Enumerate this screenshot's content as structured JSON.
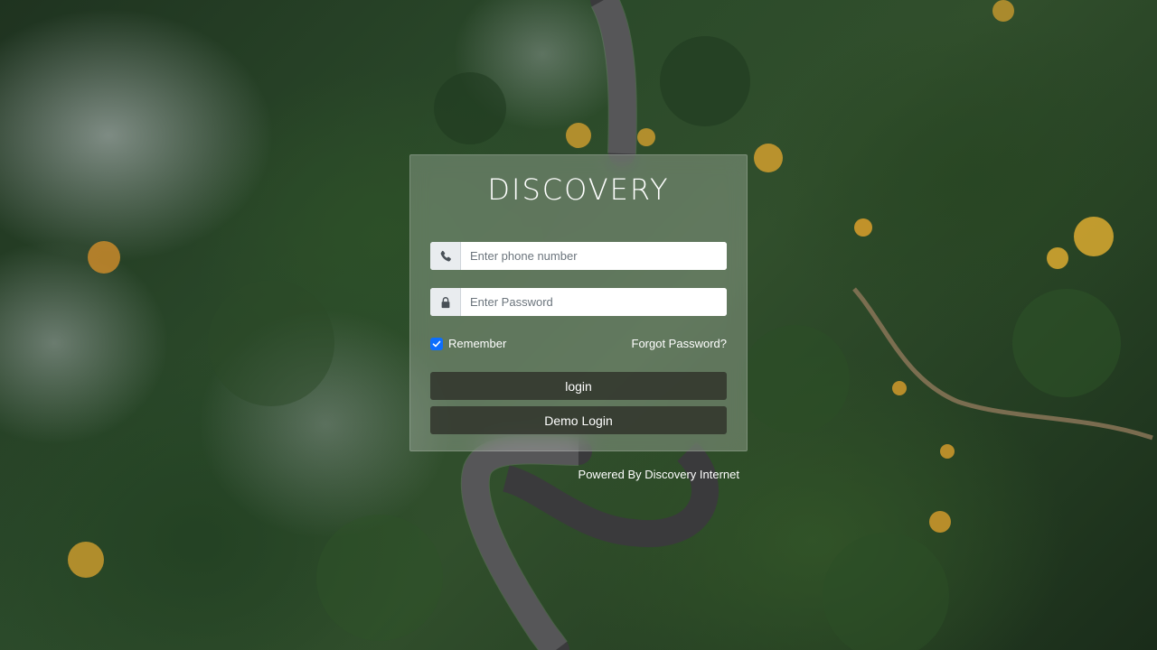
{
  "brand": {
    "title": "DISCOVERY"
  },
  "form": {
    "phone": {
      "placeholder": "Enter phone number",
      "icon": "phone-icon"
    },
    "password": {
      "placeholder": "Enter Password",
      "icon": "lock-icon"
    },
    "remember": {
      "label": "Remember",
      "checked": true
    },
    "forgot_label": "Forgot Password?",
    "login_label": "login",
    "demo_label": "Demo Login"
  },
  "footer": {
    "powered_by": "Powered By Discovery Internet"
  },
  "colors": {
    "checkbox": "#0d6efd",
    "button_bg": "#2f2f2a"
  }
}
